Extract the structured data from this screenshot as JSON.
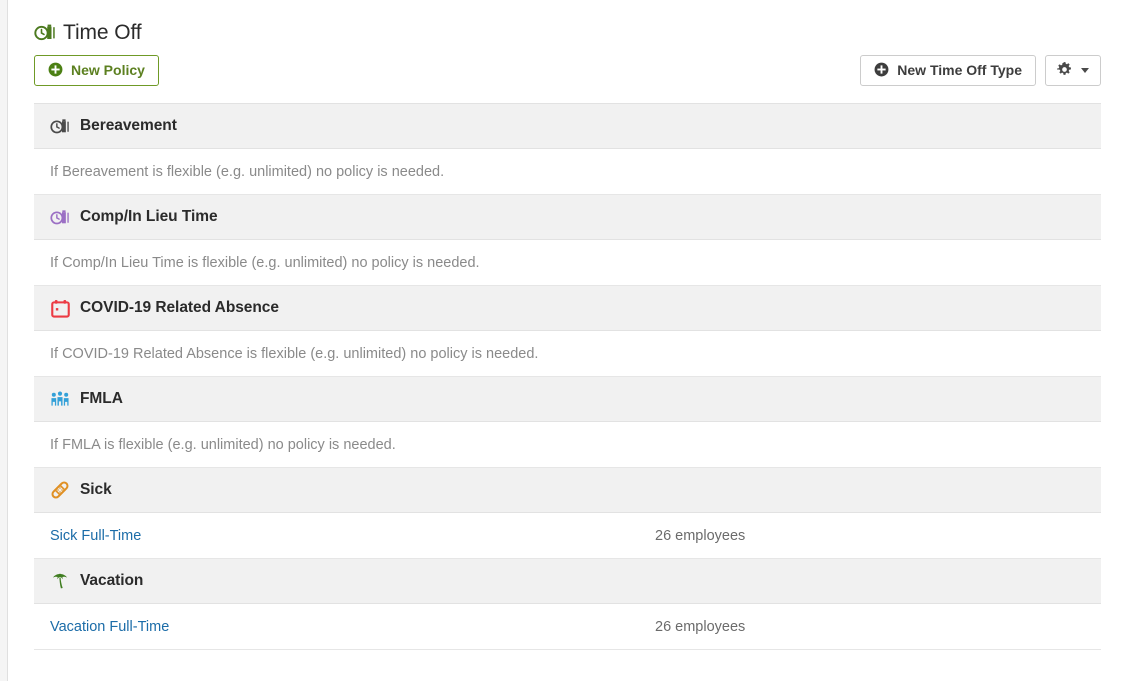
{
  "page": {
    "title": "Time Off",
    "title_icon": "time-off-clock-icon"
  },
  "toolbar": {
    "new_policy_label": "New Policy",
    "new_time_off_type_label": "New Time Off Type",
    "settings_icon": "gear-icon",
    "settings_caret_icon": "chevron-down-icon",
    "plus_icon": "plus-circle-icon"
  },
  "colors": {
    "green": "#6f9a26",
    "green_text": "#5c8020",
    "link_blue": "#1b6ca8",
    "purple": "#9b6fc4",
    "red": "#ec3b44",
    "blue": "#33a0d8",
    "orange": "#e09023",
    "palm_green": "#3f7d20",
    "header_bg": "#f1f1f1",
    "muted_text": "#8a8a8a"
  },
  "groups": [
    {
      "name": "Bereavement",
      "icon": "clock-icon",
      "icon_color": "#4a4a4a",
      "note": "If Bereavement is flexible (e.g. unlimited) no policy is needed.",
      "policies": []
    },
    {
      "name": "Comp/In Lieu Time",
      "icon": "clock-icon",
      "icon_color": "#9b6fc4",
      "note": "If Comp/In Lieu Time is flexible (e.g. unlimited) no policy is needed.",
      "policies": []
    },
    {
      "name": "COVID-19 Related Absence",
      "icon": "calendar-icon",
      "icon_color": "#ec3b44",
      "note": "If COVID-19 Related Absence is flexible (e.g. unlimited) no policy is needed.",
      "policies": []
    },
    {
      "name": "FMLA",
      "icon": "people-group-icon",
      "icon_color": "#33a0d8",
      "note": "If FMLA is flexible (e.g. unlimited) no policy is needed.",
      "policies": []
    },
    {
      "name": "Sick",
      "icon": "bandage-icon",
      "icon_color": "#e09023",
      "note": null,
      "policies": [
        {
          "name": "Sick Full-Time",
          "count": "26 employees"
        }
      ]
    },
    {
      "name": "Vacation",
      "icon": "palm-tree-icon",
      "icon_color": "#3f7d20",
      "note": null,
      "policies": [
        {
          "name": "Vacation Full-Time",
          "count": "26 employees"
        }
      ]
    }
  ]
}
